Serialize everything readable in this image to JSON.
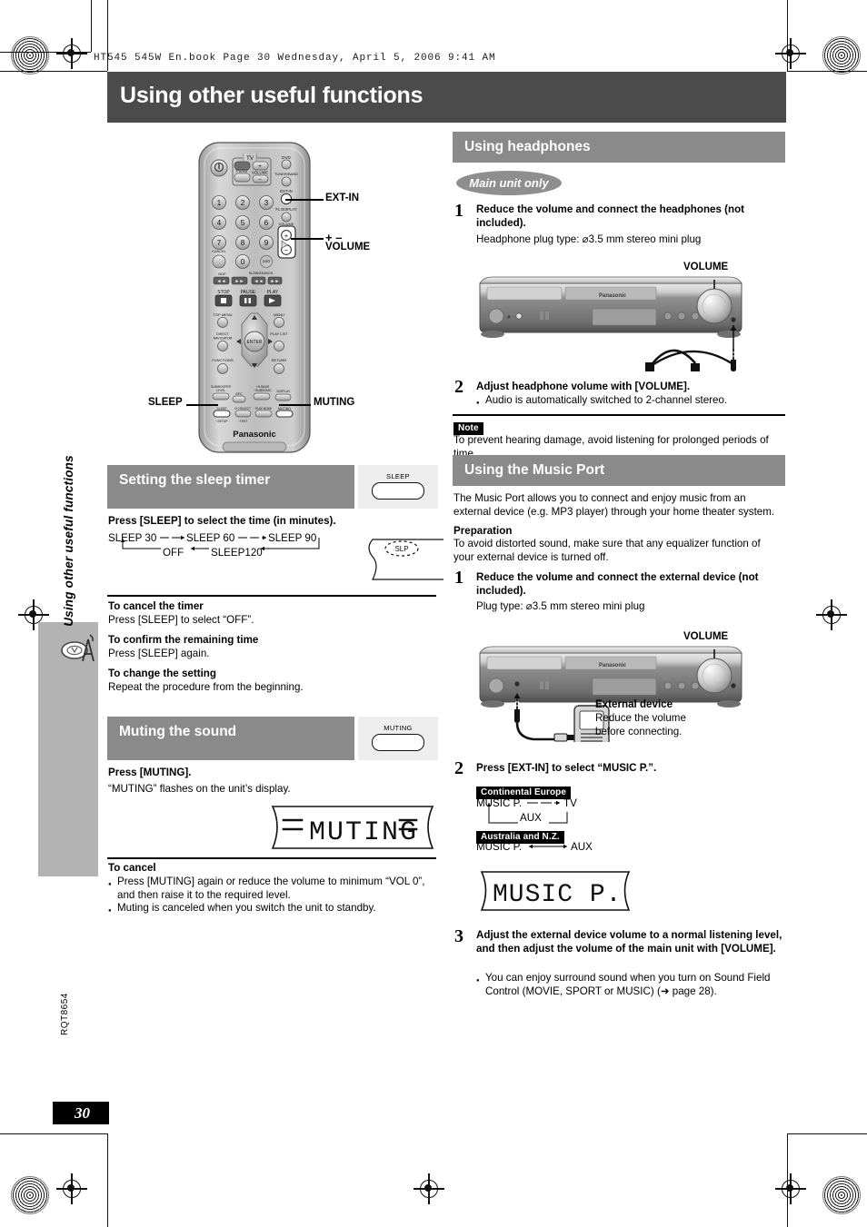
{
  "print_header": "HT545 545W En.book  Page 30  Wednesday, April 5, 2006  9:41 AM",
  "page_title": "Using other useful functions",
  "side_tab": "Using other useful functions",
  "page_number": "30",
  "doc_code": "RQT8654",
  "colors": {
    "title_bar": "#4b4b4b",
    "section_header": "#8a8a8a",
    "key_box": "#eeeeee",
    "tab_gray": "#b3b3b3",
    "badge_black": "#000000"
  },
  "remote": {
    "brand": "Panasonic",
    "callouts": {
      "ext_in": "EXT-IN",
      "volume": "VOLUME",
      "volume_plusminus": "+ –",
      "sleep": "SLEEP",
      "muting": "MUTING"
    },
    "keys": {
      "tv_group": "TV",
      "tv_vol": "VOLUME",
      "tvav": "TV/AV",
      "dvd": "DVD",
      "tuner_band": "TUNER/BAND",
      "ext_in": "EXT-IN",
      "fl_display": "FL DISPLAY",
      "volume": "VOLUME",
      "cancel": "CANCEL",
      "ten": "≥10",
      "skip": "SKIP",
      "slow_search": "SLOW/SEARCH",
      "stop": "STOP",
      "pause": "PAUSE",
      "play": "PLAY",
      "top_menu": "TOP MENU",
      "menu": "MENU",
      "direct_navigator": "DIRECT NAVIGATOR",
      "play_list": "PLAY LIST",
      "functions": "FUNCTIONS",
      "return": "RETURN",
      "enter": "ENTER",
      "subwoofer_level": "SUBWOOFER LEVEL",
      "sfc": "SFC",
      "h_bass_subsonic": "+H.BASS –SUBSONIC",
      "display": "DISPLAY",
      "sleep_setup": "SLEEP –SETUP",
      "ch_select_test": "CH SELECT –TEST",
      "play_mode": "PLAY MODE",
      "muting": "MUTING",
      "numbers": [
        "1",
        "2",
        "3",
        "4",
        "5",
        "6",
        "7",
        "8",
        "9",
        "0"
      ]
    }
  },
  "sleep_section": {
    "heading": "Setting the sleep timer",
    "key_label": "SLEEP",
    "instruction": "Press [SLEEP] to select the time (in minutes).",
    "flow": {
      "row1": [
        "SLEEP 30",
        "SLEEP 60",
        "SLEEP 90"
      ],
      "row2": [
        "OFF",
        "SLEEP120"
      ]
    },
    "display_indicator": "SLP",
    "subsections": [
      {
        "title": "To cancel the timer",
        "body": "Press [SLEEP] to select “OFF”."
      },
      {
        "title": "To confirm the remaining time",
        "body": "Press [SLEEP] again."
      },
      {
        "title": "To change the setting",
        "body": "Repeat the procedure from the beginning."
      }
    ]
  },
  "muting_section": {
    "heading": "Muting the sound",
    "key_label": "MUTING",
    "instruction": "Press [MUTING].",
    "note": "“MUTING” flashes on the unit’s display.",
    "display_text": "MUTING",
    "cancel_title": "To cancel",
    "cancel_items": [
      "Press [MUTING] again or reduce the volume to minimum “VOL 0”, and then raise it to the required level.",
      "Muting is canceled when you switch the unit to standby."
    ]
  },
  "headphones_section": {
    "heading": "Using headphones",
    "badge": "Main unit only",
    "steps": [
      {
        "num": "1",
        "title": "Reduce the volume and connect the headphones (not included).",
        "body": "Headphone plug type:  ⌀3.5 mm stereo mini plug"
      },
      {
        "num": "2",
        "title": "Adjust headphone volume with [VOLUME].",
        "bullet": "Audio is automatically switched to 2-channel stereo."
      }
    ],
    "diagram_label": "VOLUME",
    "unit_brand": "Panasonic",
    "note_badge": "Note",
    "note_text": "To prevent hearing damage, avoid listening for prolonged periods of time."
  },
  "music_port_section": {
    "heading": "Using the Music Port",
    "intro": "The Music Port allows you to connect and enjoy music from an external device (e.g. MP3 player) through your home theater system.",
    "preparation_title": "Preparation",
    "preparation_body": "To avoid distorted sound, make sure that any equalizer function of your external device is turned off.",
    "steps": [
      {
        "num": "1",
        "title": "Reduce the volume and connect the external device (not included).",
        "body": "Plug type:  ⌀3.5 mm stereo mini plug"
      },
      {
        "num": "2",
        "title": "Press [EXT-IN] to select “MUSIC P.”.",
        "regions": [
          {
            "badge": "Continental Europe",
            "items": [
              "MUSIC P.",
              "TV",
              "AUX"
            ]
          },
          {
            "badge": "Australia and N.Z.",
            "items": [
              "MUSIC P.",
              "AUX"
            ]
          }
        ],
        "display_text": "MUSIC P."
      },
      {
        "num": "3",
        "title": "Adjust the external device volume to a normal listening level, and then adjust the volume of the main unit with [VOLUME].",
        "bullet": "You can enjoy surround sound when you turn on Sound Field Control (MOVIE, SPORT or MUSIC) (➜ page 28)."
      }
    ],
    "diagram_label": "VOLUME",
    "device_label": "External device",
    "device_body_line1": "Reduce the volume",
    "device_body_line2": "before connecting."
  }
}
